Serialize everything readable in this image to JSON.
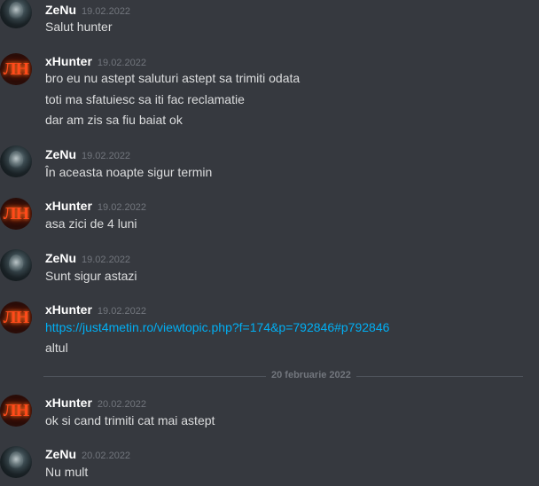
{
  "messages": [
    {
      "author": "ZeNu",
      "time": "19.02.2022",
      "lines": [
        "Salut hunter"
      ]
    },
    {
      "author": "xHunter",
      "time": "19.02.2022",
      "lines": [
        "bro eu nu astept saluturi astept sa trimiti odata",
        "toti ma sfatuiesc sa iti fac reclamatie",
        "dar am zis sa fiu baiat ok"
      ]
    },
    {
      "author": "ZeNu",
      "time": "19.02.2022",
      "lines": [
        "În aceasta noapte sigur termin"
      ]
    },
    {
      "author": "xHunter",
      "time": "19.02.2022",
      "lines": [
        "asa zici de 4 luni"
      ]
    },
    {
      "author": "ZeNu",
      "time": "19.02.2022",
      "lines": [
        "Sunt sigur astazi"
      ]
    },
    {
      "author": "xHunter",
      "time": "19.02.2022",
      "lines": [
        "https://just4metin.ro/viewtopic.php?f=174&p=792846#p792846",
        "altul"
      ]
    },
    {
      "author": "xHunter",
      "time": "20.02.2022",
      "lines": [
        "ok si cand trimiti cat mai astept"
      ]
    },
    {
      "author": "ZeNu",
      "time": "20.02.2022",
      "lines": [
        "Nu mult"
      ]
    }
  ],
  "divider": "20 februarie 2022",
  "avatar_glyph": "ЛН",
  "colors": {
    "background": "#36393f",
    "link": "#00aff4",
    "username": "#ffffff",
    "timestamp": "#72767d"
  }
}
